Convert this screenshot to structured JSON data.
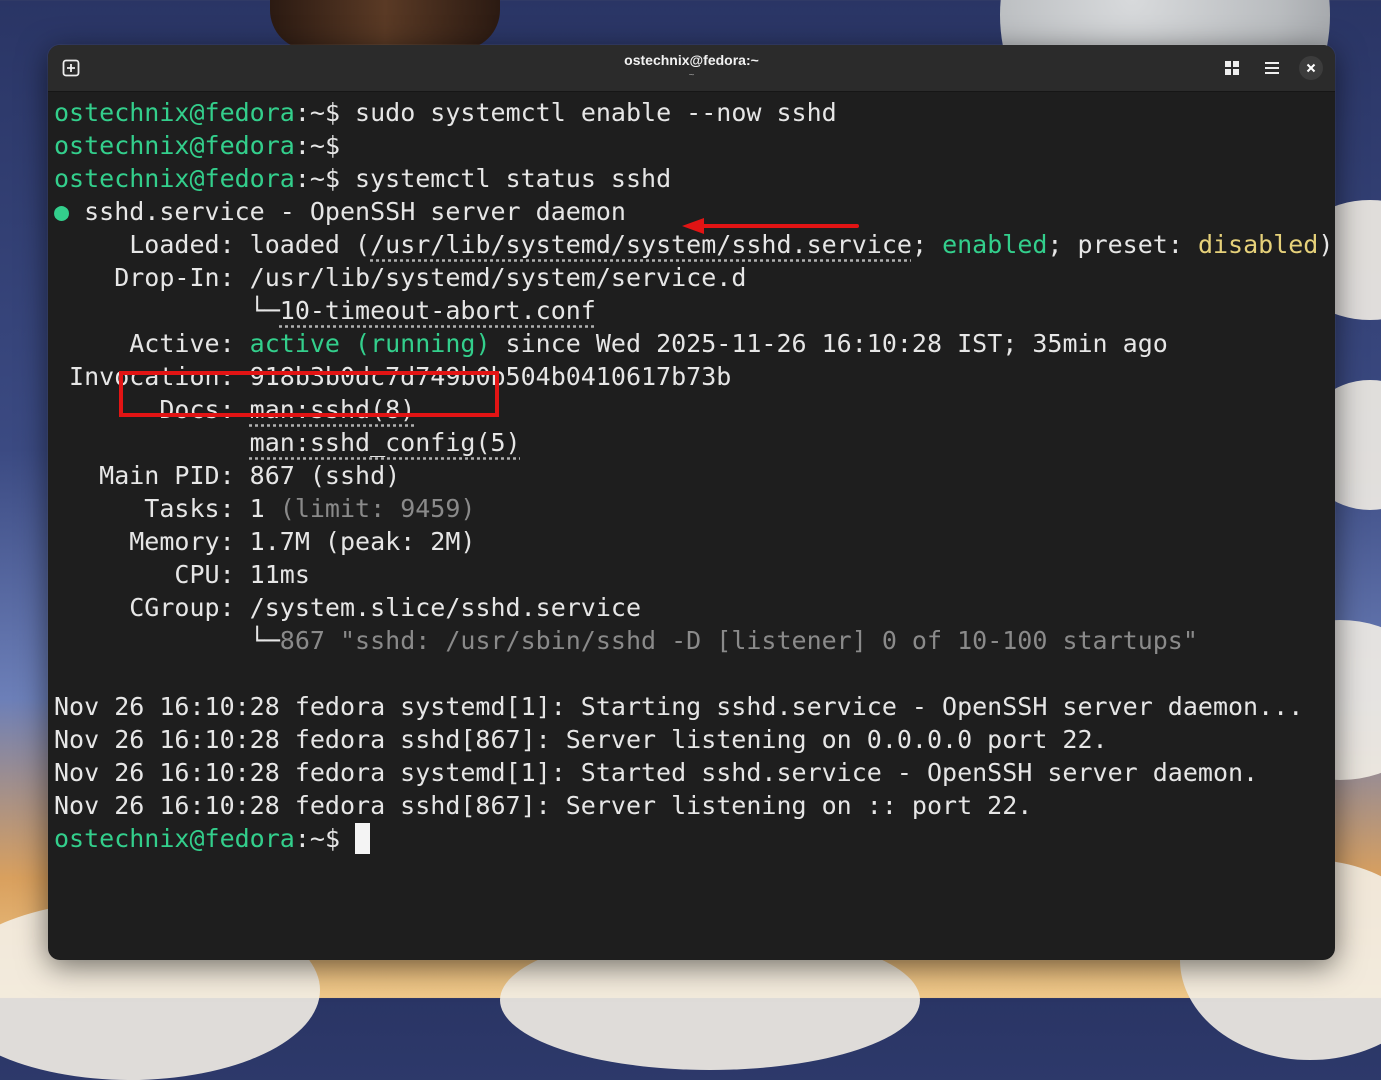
{
  "window": {
    "title": "ostechnix@fedora:~",
    "subtitle": "~",
    "icons": {
      "new_tab": "new-tab-icon",
      "grid": "grid-icon",
      "menu": "hamburger-menu-icon",
      "close": "close-icon"
    }
  },
  "colors": {
    "prompt": "#33cf8c",
    "enabled": "#33cf8c",
    "disabled": "#e6d17a",
    "annotation": "#e21414",
    "terminal_bg": "#1e1e1e"
  },
  "terminal": {
    "prompt_user_host": "ostechnix@fedora",
    "prompt_path": ":~",
    "prompt_symbol": "$",
    "cmd1": " sudo systemctl enable --now sshd",
    "cmd2": "",
    "cmd3": " systemctl status sshd",
    "bullet": "●",
    "service_line": " sshd.service - OpenSSH server daemon",
    "loaded_label": "     Loaded: ",
    "loaded_pre": "loaded (",
    "loaded_path": "/usr/lib/systemd/system/sshd.service",
    "loaded_sep": "; ",
    "loaded_enabled": "enabled",
    "loaded_preset": "; preset: ",
    "loaded_disabled": "disabled",
    "loaded_end": ")",
    "dropin_label": "    Drop-In: ",
    "dropin_path": "/usr/lib/systemd/system/service.d",
    "dropin_indent": "             ",
    "dropin_tree": "└─",
    "dropin_file": "10-timeout-abort.conf",
    "active_label": "     Active: ",
    "active_status": "active (running)",
    "active_since": " since Wed 2025-11-26 16:10:28 IST; 35min ago",
    "invocation_label": " Invocation: ",
    "invocation_value": "918b3b0dc7d749b0b504b0410617b73b",
    "docs_label": "       Docs: ",
    "docs_1": "man:sshd(8)",
    "docs_indent": "             ",
    "docs_2": "man:sshd_config(5)",
    "mainpid_label": "   Main PID: ",
    "mainpid_value": "867 (sshd)",
    "tasks_label": "      Tasks: ",
    "tasks_value": "1 ",
    "tasks_limit": "(limit: 9459)",
    "memory_label": "     Memory: ",
    "memory_value": "1.7M (peak: 2M)",
    "cpu_label": "        CPU: ",
    "cpu_value": "11ms",
    "cgroup_label": "     CGroup: ",
    "cgroup_value": "/system.slice/sshd.service",
    "cgroup_indent": "             ",
    "cgroup_tree": "└─",
    "cgroup_proc": "867 \"sshd: /usr/sbin/sshd -D [listener] 0 of 10-100 startups\"",
    "log": [
      "Nov 26 16:10:28 fedora systemd[1]: Starting sshd.service - OpenSSH server daemon...",
      "Nov 26 16:10:28 fedora sshd[867]: Server listening on 0.0.0.0 port 22.",
      "Nov 26 16:10:28 fedora systemd[1]: Started sshd.service - OpenSSH server daemon.",
      "Nov 26 16:10:28 fedora sshd[867]: Server listening on :: port 22."
    ],
    "final_cmd": " "
  }
}
